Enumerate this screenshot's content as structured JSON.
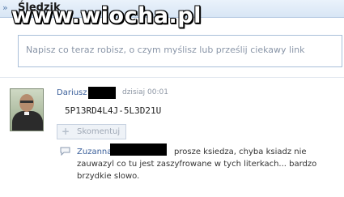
{
  "header": {
    "title": "Śledzik",
    "chevron_icon": "double-chevron-right-icon"
  },
  "watermark": {
    "text": "www.wiocha.pl"
  },
  "compose": {
    "placeholder_text": "Napisz co teraz robisz, o czym myślisz lub prześlij ciekawy link"
  },
  "post": {
    "author": "Dariusz",
    "time": "dzisiaj 00:01",
    "content": "5P13RD4L4J-5L3D21U",
    "avatar_icon": "profile-photo",
    "comment_button": {
      "label": "Skomentuj",
      "icon": "plus-icon"
    }
  },
  "comment": {
    "icon": "speech-bubble-icon",
    "author": "Zuzanna",
    "text_line1": "prosze ksiedza, chyba ksiadz nie",
    "text_line2": "zauwazyl co tu jest zaszyfrowane w tych literkach... bardzo",
    "text_line3": "brzydkie slowo."
  }
}
